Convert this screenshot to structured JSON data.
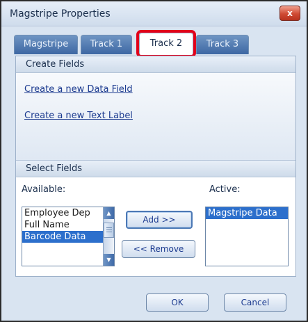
{
  "window": {
    "title": "Magstripe Properties",
    "close_label": "x"
  },
  "tabs": [
    {
      "label": "Magstripe"
    },
    {
      "label": "Track 1"
    },
    {
      "label": "Track 2",
      "active": true
    },
    {
      "label": "Track 3"
    }
  ],
  "create_fields": {
    "header": "Create Fields",
    "link_data_field": "Create a new Data Field",
    "link_text_label": "Create a new Text Label"
  },
  "select_fields": {
    "header": "Select Fields",
    "available_label": "Available:",
    "active_label": "Active:",
    "available_items": [
      "Employee Dep",
      "Full Name",
      "Barcode Data"
    ],
    "available_selected_index": 2,
    "active_items": [
      "Magstripe Data"
    ],
    "active_selected_index": 0,
    "add_label": "Add >>",
    "remove_label": "<< Remove"
  },
  "footer": {
    "ok_label": "OK",
    "cancel_label": "Cancel"
  },
  "colors": {
    "selection": "#2c6fcc",
    "tab_highlight": "#e1001a",
    "link": "#1b3a8f"
  }
}
